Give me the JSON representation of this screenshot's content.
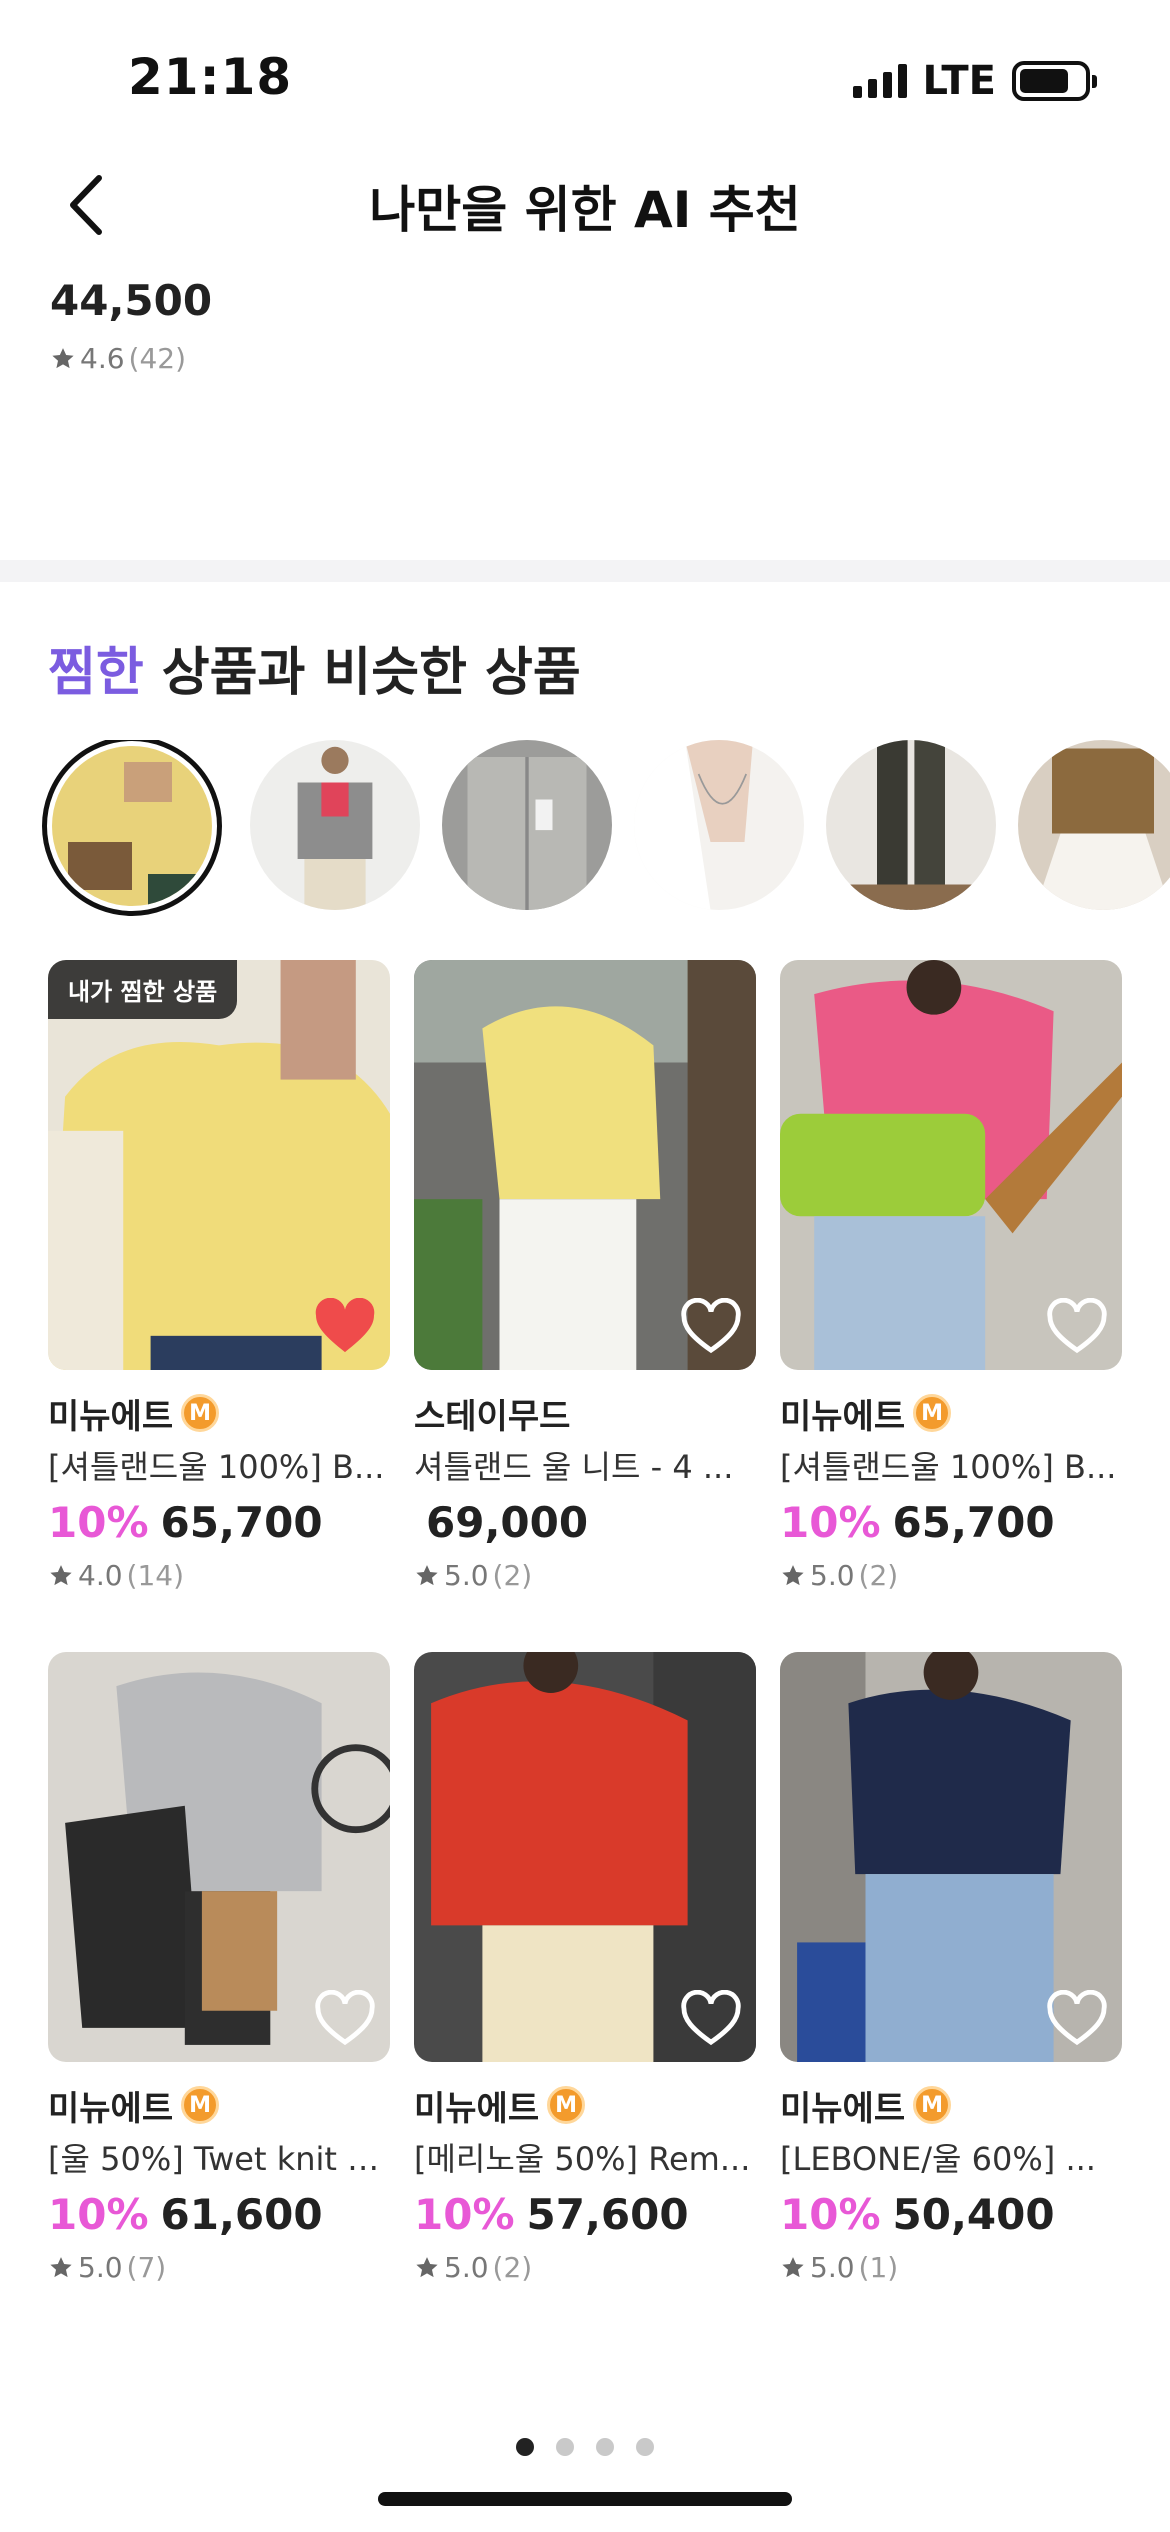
{
  "status_bar": {
    "time": "21:18",
    "network": "LTE"
  },
  "header": {
    "title": "나만을 위한 AI 추천"
  },
  "previous_item": {
    "price": "44,500",
    "rating": "4.6",
    "review_count": "(42)"
  },
  "section": {
    "title_accent": "찜한",
    "title_rest": " 상품과 비슷한 상품"
  },
  "mine_badge": "내가 찜한 상품",
  "products": [
    {
      "brand": "미뉴에트",
      "official": true,
      "name": "[셔틀랜드울 100%] B...",
      "discount": "10%",
      "price": "65,700",
      "rating": "4.0",
      "review_count": "(14)",
      "liked": true
    },
    {
      "brand": "스테이무드",
      "official": false,
      "name": "셔틀랜드 울 니트 - 4 ...",
      "discount": "",
      "price": "69,000",
      "rating": "5.0",
      "review_count": "(2)",
      "liked": false
    },
    {
      "brand": "미뉴에트",
      "official": true,
      "name": "[셔틀랜드울 100%] B...",
      "discount": "10%",
      "price": "65,700",
      "rating": "5.0",
      "review_count": "(2)",
      "liked": false
    },
    {
      "brand": "미뉴에트",
      "official": true,
      "name": "[울 50%] Twet knit (...",
      "discount": "10%",
      "price": "61,600",
      "rating": "5.0",
      "review_count": "(7)",
      "liked": false
    },
    {
      "brand": "미뉴에트",
      "official": true,
      "name": "[메리노울 50%] Rem...",
      "discount": "10%",
      "price": "57,600",
      "rating": "5.0",
      "review_count": "(2)",
      "liked": false
    },
    {
      "brand": "미뉴에트",
      "official": true,
      "name": "[LEBONE/울 60%] ...",
      "discount": "10%",
      "price": "50,400",
      "rating": "5.0",
      "review_count": "(1)",
      "liked": false
    }
  ],
  "official_badge_letter": "M",
  "pager": {
    "total": 4,
    "active": 1
  },
  "colors": {
    "accent_purple": "#7b5ce0",
    "discount_pink": "#e858d6",
    "heart_red": "#ef4b4b",
    "badge_orange": "#f39b2c"
  }
}
